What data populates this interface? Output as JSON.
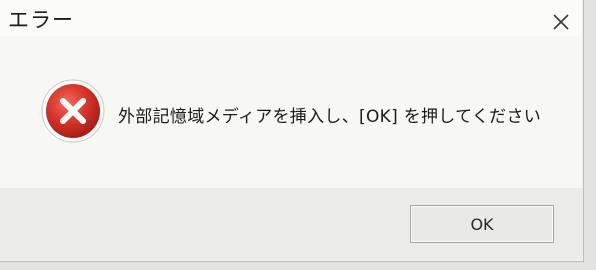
{
  "window": {
    "title": "エラー",
    "close_icon": "close-icon"
  },
  "dialog": {
    "icon": "error-icon",
    "message": "外部記憶域メディアを挿入し、[OK] を押してください",
    "ok_label": "OK"
  },
  "colors": {
    "error_red": "#d8342a",
    "background": "#f3f3ef"
  }
}
